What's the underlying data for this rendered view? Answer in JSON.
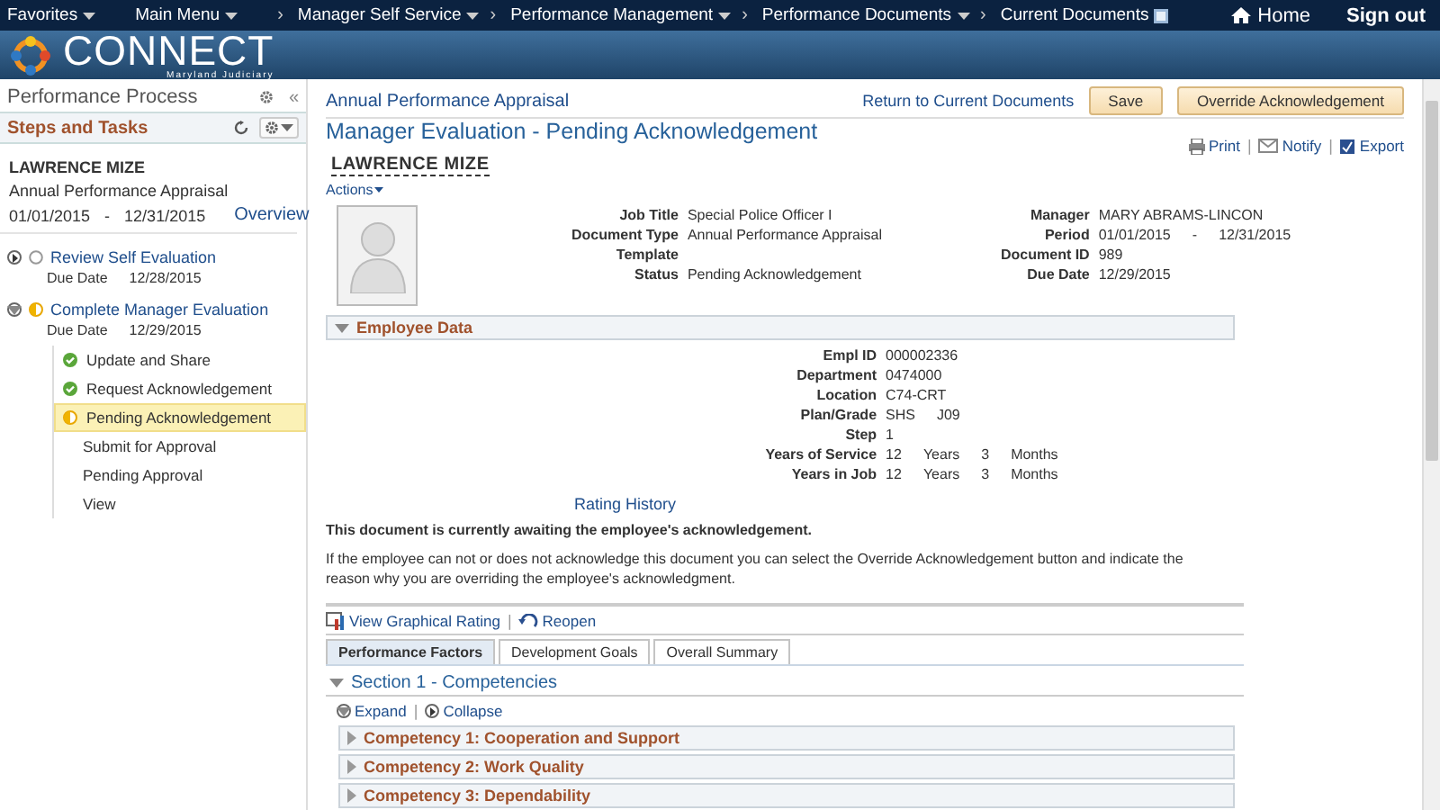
{
  "nav": {
    "items": [
      {
        "label": "Favorites",
        "kind": "menu"
      },
      {
        "label": "Main Menu",
        "kind": "menu"
      },
      {
        "label": "Manager Self Service",
        "kind": "menu",
        "separator": "›"
      },
      {
        "label": "Performance Management",
        "kind": "menu",
        "separator": "›"
      },
      {
        "label": "Performance Documents",
        "kind": "menu",
        "separator": "›"
      },
      {
        "label": "Current Documents",
        "kind": "current",
        "separator": "›"
      }
    ],
    "home": "Home",
    "signout": "Sign out"
  },
  "logo": {
    "name": "CONNECT",
    "subtitle": "Maryland Judiciary"
  },
  "sidebar": {
    "title": "Performance Process",
    "collapse": "«",
    "section_title": "Steps and Tasks",
    "employee": {
      "name": "LAWRENCE MIZE",
      "document": "Annual Performance Appraisal",
      "start": "01/01/2015",
      "separator": "-",
      "end": "12/31/2015",
      "overview": "Overview"
    },
    "steps": [
      {
        "label": "Review Self Evaluation",
        "due_label": "Due Date",
        "due": "12/28/2015",
        "expanded": false,
        "kind": "not_started"
      },
      {
        "label": "Complete Manager Evaluation",
        "due_label": "Due Date",
        "due": "12/29/2015",
        "expanded": true,
        "kind": "in_progress",
        "children": [
          {
            "label": "Update and Share",
            "kind": "complete",
            "selected": false
          },
          {
            "label": "Request Acknowledgement",
            "kind": "complete",
            "selected": false
          },
          {
            "label": "Pending Acknowledgement",
            "kind": "in_progress",
            "selected": true
          },
          {
            "label": "Submit for Approval",
            "kind": "plain",
            "selected": false
          },
          {
            "label": "Pending Approval",
            "kind": "plain",
            "selected": false
          },
          {
            "label": "View",
            "kind": "plain",
            "selected": false
          }
        ]
      }
    ]
  },
  "main": {
    "document_title": "Annual Performance Appraisal",
    "return_link": "Return to Current Documents",
    "buttons": [
      "Save",
      "Override Acknowledgement"
    ],
    "page_title": "Manager Evaluation - Pending Acknowledgement",
    "employee_name": "LAWRENCE MIZE",
    "actions": "Actions",
    "tools": [
      {
        "kind": "print",
        "label": "Print"
      },
      {
        "kind": "notify",
        "label": "Notify",
        "separator": "|"
      },
      {
        "kind": "export",
        "label": "Export",
        "separator": "|"
      }
    ],
    "fields_left": [
      {
        "label": "Job Title",
        "values": [
          "Special Police Officer I"
        ]
      },
      {
        "label": "Document Type",
        "values": [
          "Annual Performance Appraisal"
        ]
      },
      {
        "label": "Template"
      },
      {
        "label": "Status",
        "values": [
          "Pending Acknowledgement"
        ]
      }
    ],
    "fields_right": [
      {
        "label": "Manager",
        "values": [
          "MARY ABRAMS-LINCON"
        ]
      },
      {
        "label": "Period",
        "values": [
          "01/01/2015",
          "-",
          "12/31/2015"
        ]
      },
      {
        "label": "Document ID",
        "values": [
          "989"
        ]
      },
      {
        "label": "Due Date",
        "values": [
          "12/29/2015"
        ]
      }
    ],
    "employee_data": {
      "title": "Employee Data",
      "expanded": true,
      "fields": [
        {
          "label": "Empl ID",
          "values": [
            "000002336"
          ]
        },
        {
          "label": "Department",
          "values": [
            "0474000"
          ]
        },
        {
          "label": "Location",
          "values": [
            "C74-CRT"
          ]
        },
        {
          "label": "Plan/Grade",
          "values": [
            "SHS",
            "J09"
          ]
        },
        {
          "label": "Step",
          "values": [
            "1"
          ]
        },
        {
          "label": "Years of Service",
          "values": [
            "12",
            "Years",
            "3",
            "Months"
          ]
        },
        {
          "label": "Years in Job",
          "values": [
            "12",
            "Years",
            "3",
            "Months"
          ]
        }
      ]
    },
    "rating_history": "Rating History",
    "notice_bold": "This document is currently awaiting the employee's acknowledgement.",
    "notice": "If the employee can not or does not acknowledge this document you can select the Override Acknowledgement button and indicate the reason why you are overriding the employee's acknowledgment.",
    "links": [
      {
        "kind": "chart",
        "label": "View Graphical Rating"
      },
      {
        "kind": "reopen",
        "label": "Reopen",
        "separator": "|"
      }
    ],
    "tabs": [
      {
        "label": "Performance Factors",
        "selected": true
      },
      {
        "label": "Development Goals",
        "selected": false
      },
      {
        "label": "Overall Summary",
        "selected": false
      }
    ],
    "section": {
      "title": "Section 1 - Competencies",
      "expanded": true
    },
    "expand": "Expand",
    "expand_separator": "|",
    "collapse": "Collapse",
    "competencies": [
      {
        "label": "Competency 1: Cooperation and Support",
        "expanded": false
      },
      {
        "label": "Competency 2: Work Quality",
        "expanded": false
      },
      {
        "label": "Competency 3: Dependability",
        "expanded": false
      }
    ]
  }
}
